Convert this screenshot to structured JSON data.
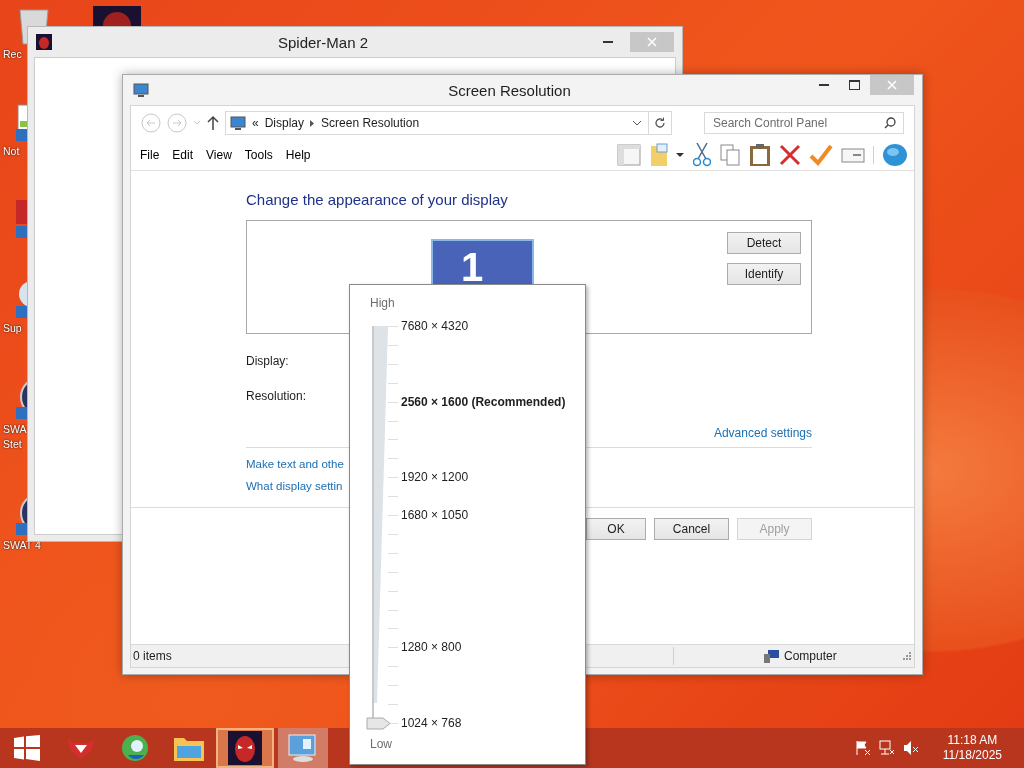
{
  "desktop_icons": [
    {
      "kind": "recycle-bin",
      "label_lines": [
        "Rec"
      ]
    },
    {
      "kind": "notepad",
      "label_lines": [
        "Not"
      ]
    },
    {
      "kind": "media"
    },
    {
      "kind": "ball",
      "label_lines": [
        "Sup"
      ]
    },
    {
      "kind": "game",
      "label_lines": [
        "SWA",
        "Stet"
      ]
    },
    {
      "kind": "game",
      "label_lines": [
        "SWAT 4"
      ]
    }
  ],
  "back_window": {
    "title": "Spider-Man 2"
  },
  "window": {
    "title": "Screen Resolution",
    "breadcrumb_prefix": "«",
    "breadcrumb": [
      "Display",
      "Screen Resolution"
    ],
    "search": {
      "placeholder": "Search Control Panel"
    },
    "menu": [
      "File",
      "Edit",
      "View",
      "Tools",
      "Help"
    ],
    "heading": "Change the appearance of your display",
    "monitor_number": "1",
    "side_buttons": [
      "Detect",
      "Identify"
    ],
    "fields": [
      "Display:",
      "Resolution:"
    ],
    "advanced_link": "Advanced settings",
    "links": [
      "Make text and othe",
      "What display settin"
    ],
    "buttons": [
      {
        "label": "OK",
        "disabled": false
      },
      {
        "label": "Cancel",
        "disabled": false
      },
      {
        "label": "Apply",
        "disabled": true
      }
    ],
    "status": "0 items",
    "status_location": "Computer"
  },
  "resolution_popup": {
    "high_label": "High",
    "low_label": "Low",
    "level": 0,
    "options": [
      {
        "label": "7680 × 4320",
        "recommended": false
      },
      {
        "label": "2560 × 1600 (Recommended)",
        "recommended": true
      },
      {
        "label": "1920 × 1200",
        "recommended": false
      },
      {
        "label": "1680 × 1050",
        "recommended": false
      },
      {
        "label": "1280 × 800",
        "recommended": false
      },
      {
        "label": "1024 × 768",
        "recommended": false
      }
    ]
  },
  "taskbar": {
    "buttons": [
      {
        "kind": "start",
        "highlighted": false,
        "pressed": false
      },
      {
        "kind": "fox",
        "highlighted": false,
        "pressed": false
      },
      {
        "kind": "globe",
        "highlighted": false,
        "pressed": false
      },
      {
        "kind": "folder",
        "highlighted": false,
        "pressed": false
      },
      {
        "kind": "spider",
        "highlighted": true,
        "pressed": false
      },
      {
        "kind": "display",
        "highlighted": false,
        "pressed": true
      }
    ],
    "time": "11:18 AM",
    "date": "11/18/2025"
  }
}
